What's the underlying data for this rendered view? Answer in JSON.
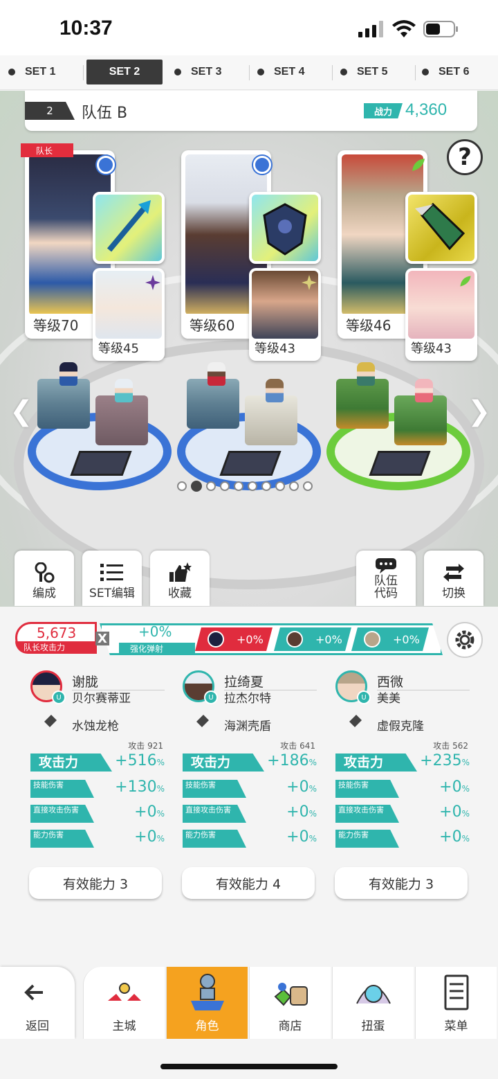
{
  "status_bar": {
    "time": "10:37"
  },
  "set_tabs": [
    {
      "label": "SET 1",
      "active": false
    },
    {
      "label": "SET 2",
      "active": true
    },
    {
      "label": "SET 3",
      "active": false
    },
    {
      "label": "SET 4",
      "active": false
    },
    {
      "label": "SET 5",
      "active": false
    },
    {
      "label": "SET 6",
      "active": false
    }
  ],
  "team": {
    "number": "2",
    "name": "队伍 B",
    "power_label": "战力",
    "power_value": "4,360"
  },
  "leader_tag": "队长",
  "cards": [
    {
      "level": "等级70",
      "sub_level": "等级45",
      "element_color": "#3a73d6",
      "weapon_color": "#6bd0c8"
    },
    {
      "level": "等级60",
      "sub_level": "等级43",
      "element_color": "#3a73d6",
      "weapon_color": "#4a86c8"
    },
    {
      "level": "等级46",
      "sub_level": "等级43",
      "element_color": "#6ccc3c",
      "weapon_color": "#c9b51c"
    }
  ],
  "pager": {
    "count": 10,
    "active": 1
  },
  "scene_buttons": {
    "formation": "编成",
    "set_edit": "SET编辑",
    "favorite": "收藏",
    "team_code_1": "队伍",
    "team_code_2": "代码",
    "switch": "切换"
  },
  "boost": {
    "leader_attack_value": "5,673",
    "leader_attack_label": "队长攻击力",
    "x": "X",
    "pinball_value": "+0%",
    "pinball_label": "强化弹射",
    "chips": [
      "+0%",
      "+0%",
      "+0%"
    ]
  },
  "members": [
    {
      "name": "谢胧",
      "sub": "贝尔赛蒂亚",
      "weapon": "水蚀龙枪",
      "attack_label": "攻击力",
      "attack_base": "攻击  921",
      "attack_pct": "+516",
      "skill_dmg_label": "技能伤害",
      "skill_dmg": "+130",
      "direct_dmg_label": "直接攻击伤害",
      "direct_dmg": "+0",
      "ability_dmg_label": "能力伤害",
      "ability_dmg": "+0",
      "ability_count": "有效能力 3"
    },
    {
      "name": "拉绮夏",
      "sub": "拉杰尔特",
      "weapon": "海渊壳盾",
      "attack_label": "攻击力",
      "attack_base": "攻击  641",
      "attack_pct": "+186",
      "skill_dmg_label": "技能伤害",
      "skill_dmg": "+0",
      "direct_dmg_label": "直接攻击伤害",
      "direct_dmg": "+0",
      "ability_dmg_label": "能力伤害",
      "ability_dmg": "+0",
      "ability_count": "有效能力 4"
    },
    {
      "name": "西微",
      "sub": "美美",
      "weapon": "虚假克隆",
      "attack_label": "攻击力",
      "attack_base": "攻击  562",
      "attack_pct": "+235",
      "skill_dmg_label": "技能伤害",
      "skill_dmg": "+0",
      "direct_dmg_label": "直接攻击伤害",
      "direct_dmg": "+0",
      "ability_dmg_label": "能力伤害",
      "ability_dmg": "+0",
      "ability_count": "有效能力 3"
    }
  ],
  "percent_sign": "%",
  "nav": {
    "back": "返回",
    "town": "主城",
    "character": "角色",
    "shop": "商店",
    "gacha": "扭蛋",
    "menu": "菜单"
  }
}
